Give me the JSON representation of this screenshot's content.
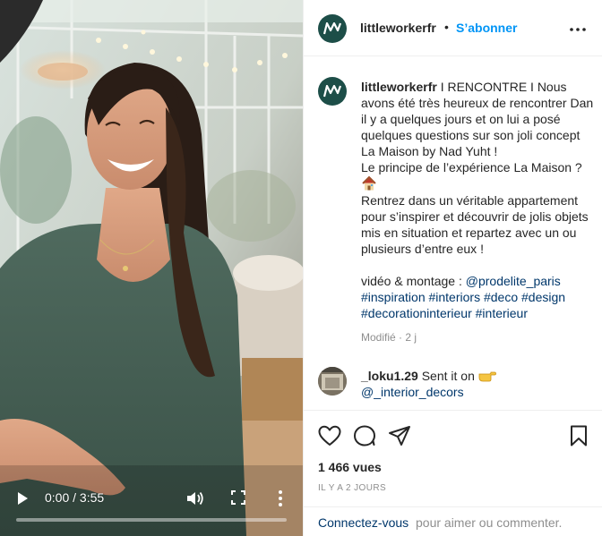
{
  "account": {
    "username": "littleworkerfr",
    "separator": "•",
    "follow_label": "S’abonner",
    "brand_color": "#1d4e48"
  },
  "video": {
    "time_label": "0:00 / 3:55",
    "progress": 0.0,
    "icons": [
      "play-icon",
      "volume-icon",
      "fullscreen-icon",
      "more-vertical-icon"
    ]
  },
  "caption": {
    "username": "littleworkerfr",
    "line1": " I RENCONTRE I Nous avons été très heureux de rencontrer Dan il y a quelques jours et on lui a posé quelques questions sur son joli concept La Maison by Nad Yuht !",
    "line2": "Le principe de l’expérience La Maison ?",
    "line3": "Rentrez dans un véritable appartement pour s’inspirer et découvrir de jolis objets mis en situation et repartez avec un ou plusieurs d’entre eux !",
    "credit_prefix": "vidéo & montage : ",
    "credit_mention": "@prodelite_paris",
    "hashtags": "#inspiration #interiors #deco #design #decorationinterieur #interieur",
    "house_icon": "house-emoji-icon",
    "meta": "Modifié · 2 j"
  },
  "comment": {
    "username": "_loku1.29",
    "text": " Sent it on ",
    "mention": "@_interior_decors",
    "hand_icon": "pointing-hand-emoji-icon"
  },
  "actions": {
    "icons": [
      "heart-icon",
      "comment-icon",
      "share-icon",
      "bookmark-icon"
    ],
    "views": "1 466 vues",
    "ago": "IL Y A 2 JOURS"
  },
  "footer": {
    "login_link": "Connectez-vous",
    "login_rest": " pour aimer ou commenter."
  }
}
